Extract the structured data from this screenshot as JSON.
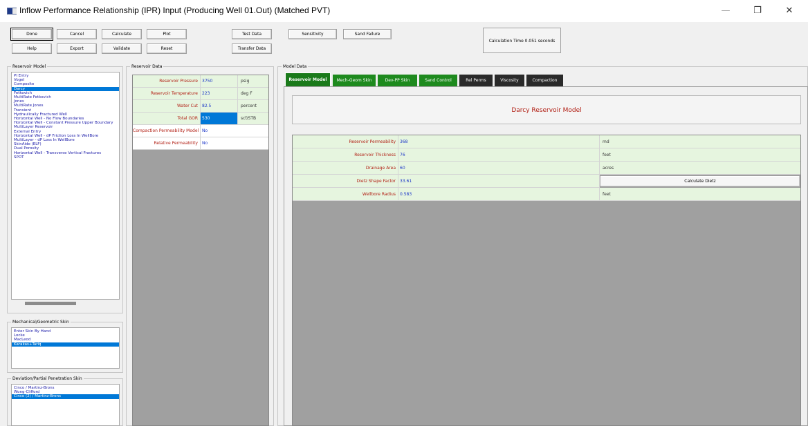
{
  "window": {
    "title": "Inflow Performance Relationship (IPR) Input (Producing Well 01.Out) (Matched PVT)",
    "minimize": "—",
    "restore": "❐",
    "close": "✕"
  },
  "toolbar": {
    "done": "Done",
    "cancel": "Cancel",
    "calculate": "Calculate",
    "plot": "Plot",
    "test_data": "Test Data",
    "sensitivity": "Sensitivity",
    "sand_failure": "Sand Failure",
    "help": "Help",
    "export": "Export",
    "validate": "Validate",
    "reset": "Reset",
    "transfer_data": "Transfer Data",
    "calc_time": "Calculation Time 0.051 seconds"
  },
  "reservoir_model": {
    "title": "Reservoir Model",
    "items": [
      "PI Entry",
      "Vogel",
      "Composite",
      "Darcy",
      "Fetkovich",
      "MultiRate Fetkovich",
      "Jones",
      "MultiRate Jones",
      "Transient",
      "Hydraulically Fractured Well",
      "Horizontal Well - No Flow Boundaries",
      "Horizontal Well - Constant Pressure Upper Boundary",
      "MultiLayer Reservoir",
      "External Entry",
      "Horizontal Well - dP Friction Loss In WellBore",
      "MultiLayer - dP Loss In WellBore",
      "SkinAide (ELF)",
      "Dual Porosity",
      "Horizontal Well - Transverse Vertical Fractures",
      "SPOT"
    ],
    "selected": "Darcy"
  },
  "mech_skin": {
    "title": "Mechanical/Geometric Skin",
    "items": [
      "Enter Skin By Hand",
      "Locke",
      "MacLeod",
      "Karakas+Tariq"
    ],
    "selected": "Karakas+Tariq"
  },
  "dev_skin": {
    "title": "Deviation/Partial Penetration Skin",
    "items": [
      "Cinco / Martinz-Brons",
      "Wong-Clifford",
      "Cinco (2) / Martinz-Brons"
    ],
    "selected": "Cinco (2) / Martinz-Brons"
  },
  "reservoir_data": {
    "title": "Reservoir Data",
    "rows": [
      {
        "label": "Reservoir Pressure",
        "value": "3750",
        "unit": "psig"
      },
      {
        "label": "Reservoir Temperature",
        "value": "223",
        "unit": "deg F"
      },
      {
        "label": "Water Cut",
        "value": "82.5",
        "unit": "percent"
      },
      {
        "label": "Total GOR",
        "value": "530",
        "unit": "scf/STB"
      },
      {
        "label": "Compaction Permeability Model",
        "value": "No",
        "unit": ""
      },
      {
        "label": "Relative Permeability",
        "value": "No",
        "unit": ""
      }
    ]
  },
  "model_data": {
    "title": "Model Data",
    "tabs": [
      "Reservoir Model",
      "Mech-Geom Skin",
      "Dev-PP Skin",
      "Sand Control",
      "Rel Perms",
      "Viscosity",
      "Compaction"
    ],
    "heading": "Darcy Reservoir Model",
    "rows": [
      {
        "label": "Reservoir Permeability",
        "value": "368",
        "unit": "md"
      },
      {
        "label": "Reservoir Thickness",
        "value": "76",
        "unit": "feet"
      },
      {
        "label": "Drainage Area",
        "value": "60",
        "unit": "acres"
      },
      {
        "label": "Dietz Shape Factor",
        "value": "33.61",
        "unit": ""
      },
      {
        "label": "Wellbore Radius",
        "value": "0.583",
        "unit": "feet"
      }
    ],
    "calc_dietz": "Calculate Dietz"
  }
}
